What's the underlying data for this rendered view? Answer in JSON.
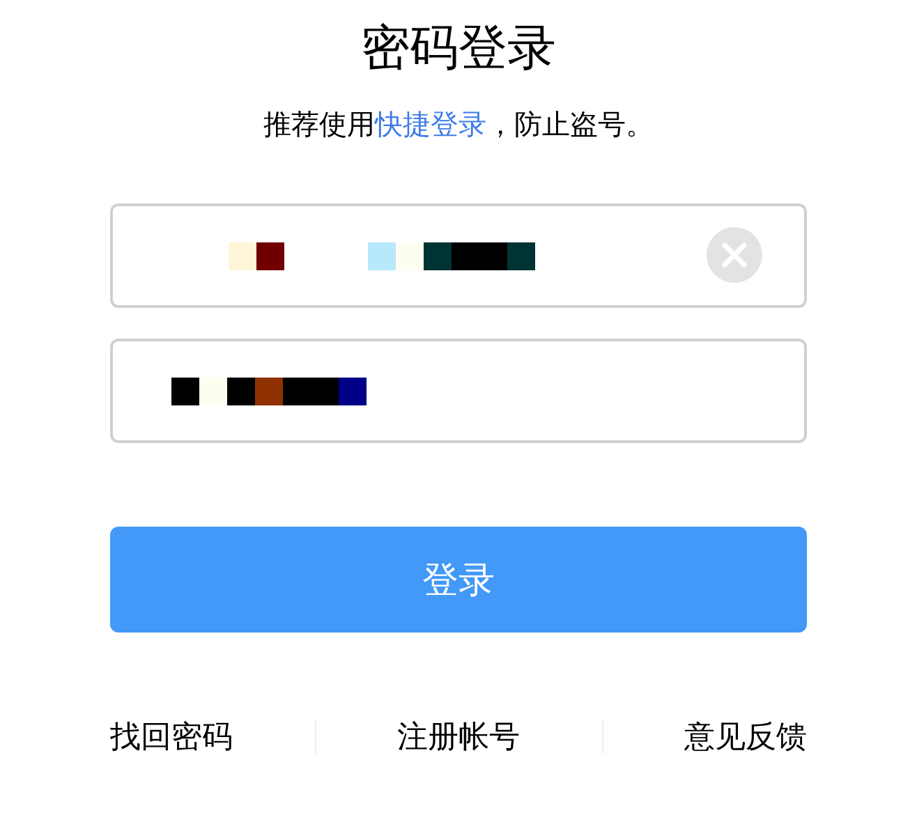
{
  "title": "密码登录",
  "hint": {
    "before": "推荐使用",
    "link": "快捷登录",
    "after": "，防止盗号。"
  },
  "fields": [
    {
      "kind": "account",
      "clearable": true
    },
    {
      "kind": "password",
      "clearable": false
    }
  ],
  "submit_button": "登录",
  "footer_links": [
    "找回密码",
    "注册帐号",
    "意见反馈"
  ]
}
